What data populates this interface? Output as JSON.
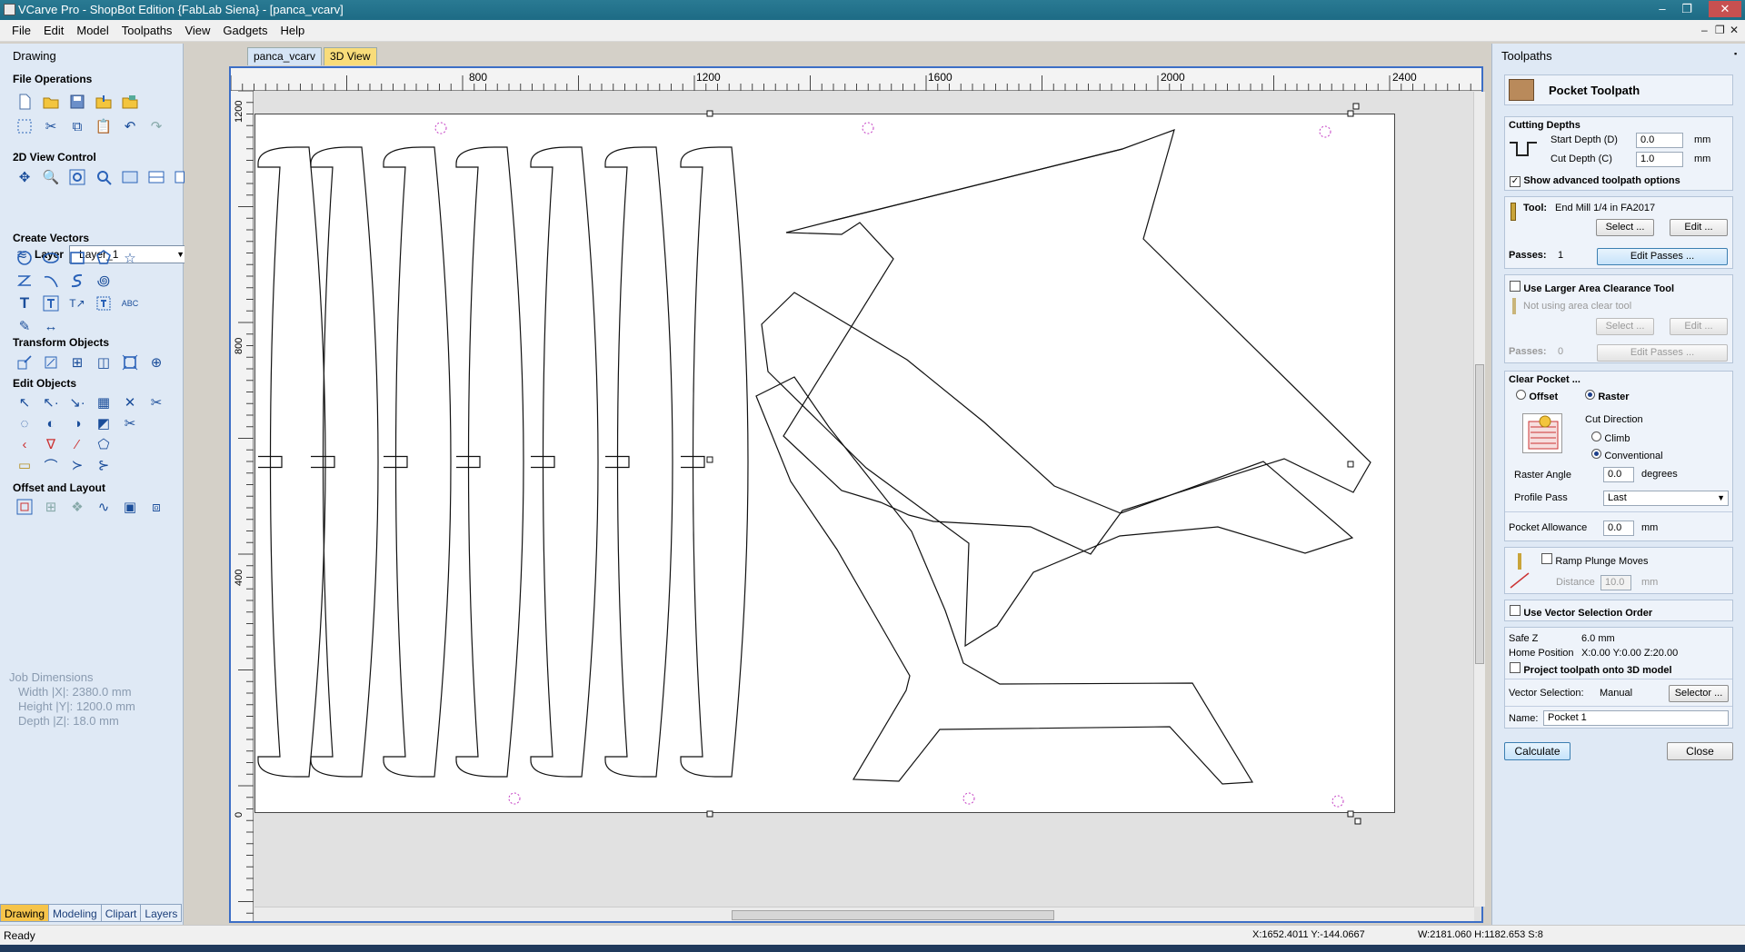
{
  "window": {
    "title": "VCarve Pro - ShopBot Edition {FabLab Siena} - [panca_vcarv]",
    "min": "–",
    "max": "❐",
    "close": "✕"
  },
  "menu": [
    "File",
    "Edit",
    "Model",
    "Toolpaths",
    "View",
    "Gadgets",
    "Help"
  ],
  "mdi": {
    "min": "–",
    "restore": "❐",
    "close": "✕"
  },
  "left_panel": {
    "header": "Drawing",
    "pin": "📌",
    "sections": {
      "file_ops": "File Operations",
      "view2d": "2D View Control",
      "layer_label": "Layer",
      "layer_value": "Layer_1",
      "create_vectors": "Create Vectors",
      "transform": "Transform Objects",
      "edit_objects": "Edit Objects",
      "offset_layout": "Offset and Layout"
    },
    "job_dimensions": {
      "title": "Job Dimensions",
      "width": "Width  |X|: 2380.0 mm",
      "height": "Height |Y|: 1200.0 mm",
      "depth": "Depth  |Z|: 18.0 mm"
    },
    "bottom_tabs": [
      "Drawing",
      "Modeling",
      "Clipart",
      "Layers"
    ]
  },
  "doc_tabs": [
    "panca_vcarv",
    "3D View"
  ],
  "rulers": {
    "h": [
      "800",
      "1200",
      "1600",
      "2000",
      "2400"
    ],
    "v": [
      "1200",
      "800",
      "400",
      "0"
    ]
  },
  "right_panel": {
    "header": "Toolpaths",
    "pin": "📌",
    "title": "Pocket Toolpath",
    "cutting_depths": "Cutting Depths",
    "start_depth_label": "Start Depth (D)",
    "start_depth": "0.0",
    "cut_depth_label": "Cut Depth (C)",
    "cut_depth": "1.0",
    "unit": "mm",
    "show_advanced": "Show advanced toolpath options",
    "tool_label": "Tool:",
    "tool_name": "End Mill 1/4 in FA2017",
    "select_btn": "Select ...",
    "edit_btn": "Edit ...",
    "passes_label": "Passes:",
    "passes_value": "1",
    "edit_passes_btn": "Edit Passes ...",
    "larger_area": "Use Larger Area Clearance Tool",
    "not_using": "Not using area clear tool",
    "select_btn2": "Select ...",
    "edit_btn2": "Edit ...",
    "passes_label2": "Passes:",
    "passes_value2": "0",
    "edit_passes_btn2": "Edit Passes ...",
    "clear_pocket": "Clear Pocket ...",
    "offset": "Offset",
    "raster": "Raster",
    "cut_direction": "Cut Direction",
    "climb": "Climb",
    "conventional": "Conventional",
    "raster_angle_label": "Raster Angle",
    "raster_angle": "0.0",
    "degrees": "degrees",
    "profile_pass_label": "Profile Pass",
    "profile_pass": "Last",
    "pocket_allowance_label": "Pocket Allowance",
    "pocket_allowance": "0.0",
    "ramp": "Ramp Plunge Moves",
    "distance_label": "Distance",
    "distance": "10.0",
    "vector_order": "Use Vector Selection Order",
    "safe_z_label": "Safe Z",
    "safe_z": "6.0 mm",
    "home_label": "Home Position",
    "home": "X:0.00 Y:0.00 Z:20.00",
    "project": "Project toolpath onto 3D model",
    "vector_sel_label": "Vector Selection:",
    "vector_sel": "Manual",
    "selector_btn": "Selector ...",
    "name_label": "Name:",
    "name": "Pocket 1",
    "calculate": "Calculate",
    "close": "Close"
  },
  "status": {
    "left": "Ready",
    "coords": "X:1652.4011 Y:-144.0667",
    "size": "W:2181.060  H:1182.653  S:8"
  }
}
